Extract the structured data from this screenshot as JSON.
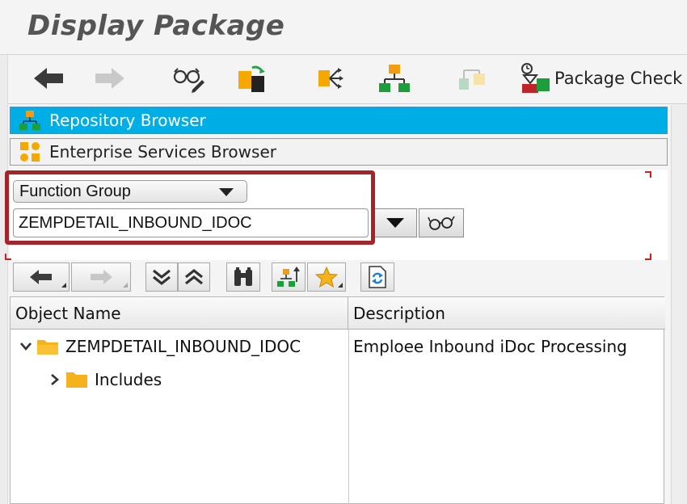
{
  "window": {
    "title": "Display Package"
  },
  "toolbar": {
    "package_check_label": "Package Check"
  },
  "nav": {
    "repository_browser": "Repository Browser",
    "enterprise_services_browser": "Enterprise Services Browser"
  },
  "object_selector": {
    "type_value": "Function Group",
    "name_value": "ZEMPDETAIL_INBOUND_IDOC"
  },
  "tree": {
    "columns": [
      "Object Name",
      "Description"
    ],
    "rows": [
      {
        "name": "ZEMPDETAIL_INBOUND_IDOC",
        "description": "Emploee Inbound iDoc Processing",
        "expanded": true
      },
      {
        "name": "Includes",
        "description": "",
        "expanded": false
      }
    ]
  },
  "colors": {
    "selection_blue": "#00aee6",
    "highlight_red": "#a4242a",
    "folder_yellow": "#f5b21a",
    "hierarchy_orange": "#f39c12",
    "hierarchy_green": "#1e9e3b"
  },
  "icons": {
    "back": "arrow-left-icon",
    "forward": "arrow-right-icon",
    "display_change": "glasses-pencil-icon",
    "other_object": "object-swap-icon",
    "where_used": "where-used-icon",
    "object_list": "hierarchy-icon",
    "display_object_list": "hierarchy-disabled-icon",
    "package_check": "package-check-icon"
  }
}
